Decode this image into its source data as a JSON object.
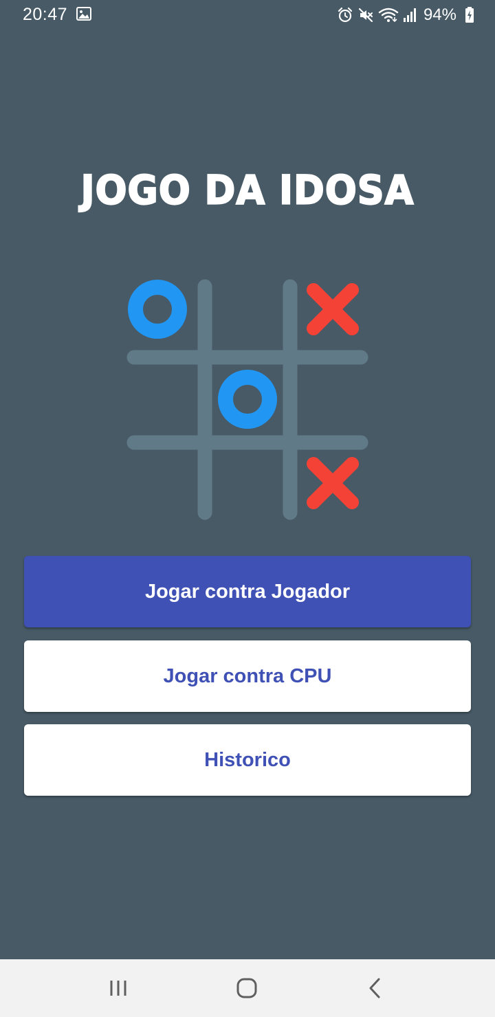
{
  "status_bar": {
    "time": "20:47",
    "notification_icons": [
      "gallery-icon"
    ],
    "system_icons": [
      "alarm-icon",
      "mute-icon",
      "wifi-icon",
      "signal-icon"
    ],
    "battery_percent": "94%",
    "battery_icon": "battery-charging-icon"
  },
  "app": {
    "title": "JOGO DA IDOSA",
    "board": {
      "cells": [
        "O",
        "",
        "X",
        "",
        "O",
        "",
        "",
        "",
        "X"
      ]
    },
    "buttons": {
      "vs_player": "Jogar contra Jogador",
      "vs_cpu": "Jogar contra CPU",
      "history": "Historico"
    }
  },
  "nav_bar": {
    "icons": [
      "recents-icon",
      "home-icon",
      "back-icon"
    ]
  },
  "colors": {
    "background": "#475a66",
    "board_lines": "#617a87",
    "o_mark": "#2196f3",
    "x_mark": "#f44336",
    "primary": "#3f51b5",
    "nav_bar": "#f2f2f2"
  }
}
